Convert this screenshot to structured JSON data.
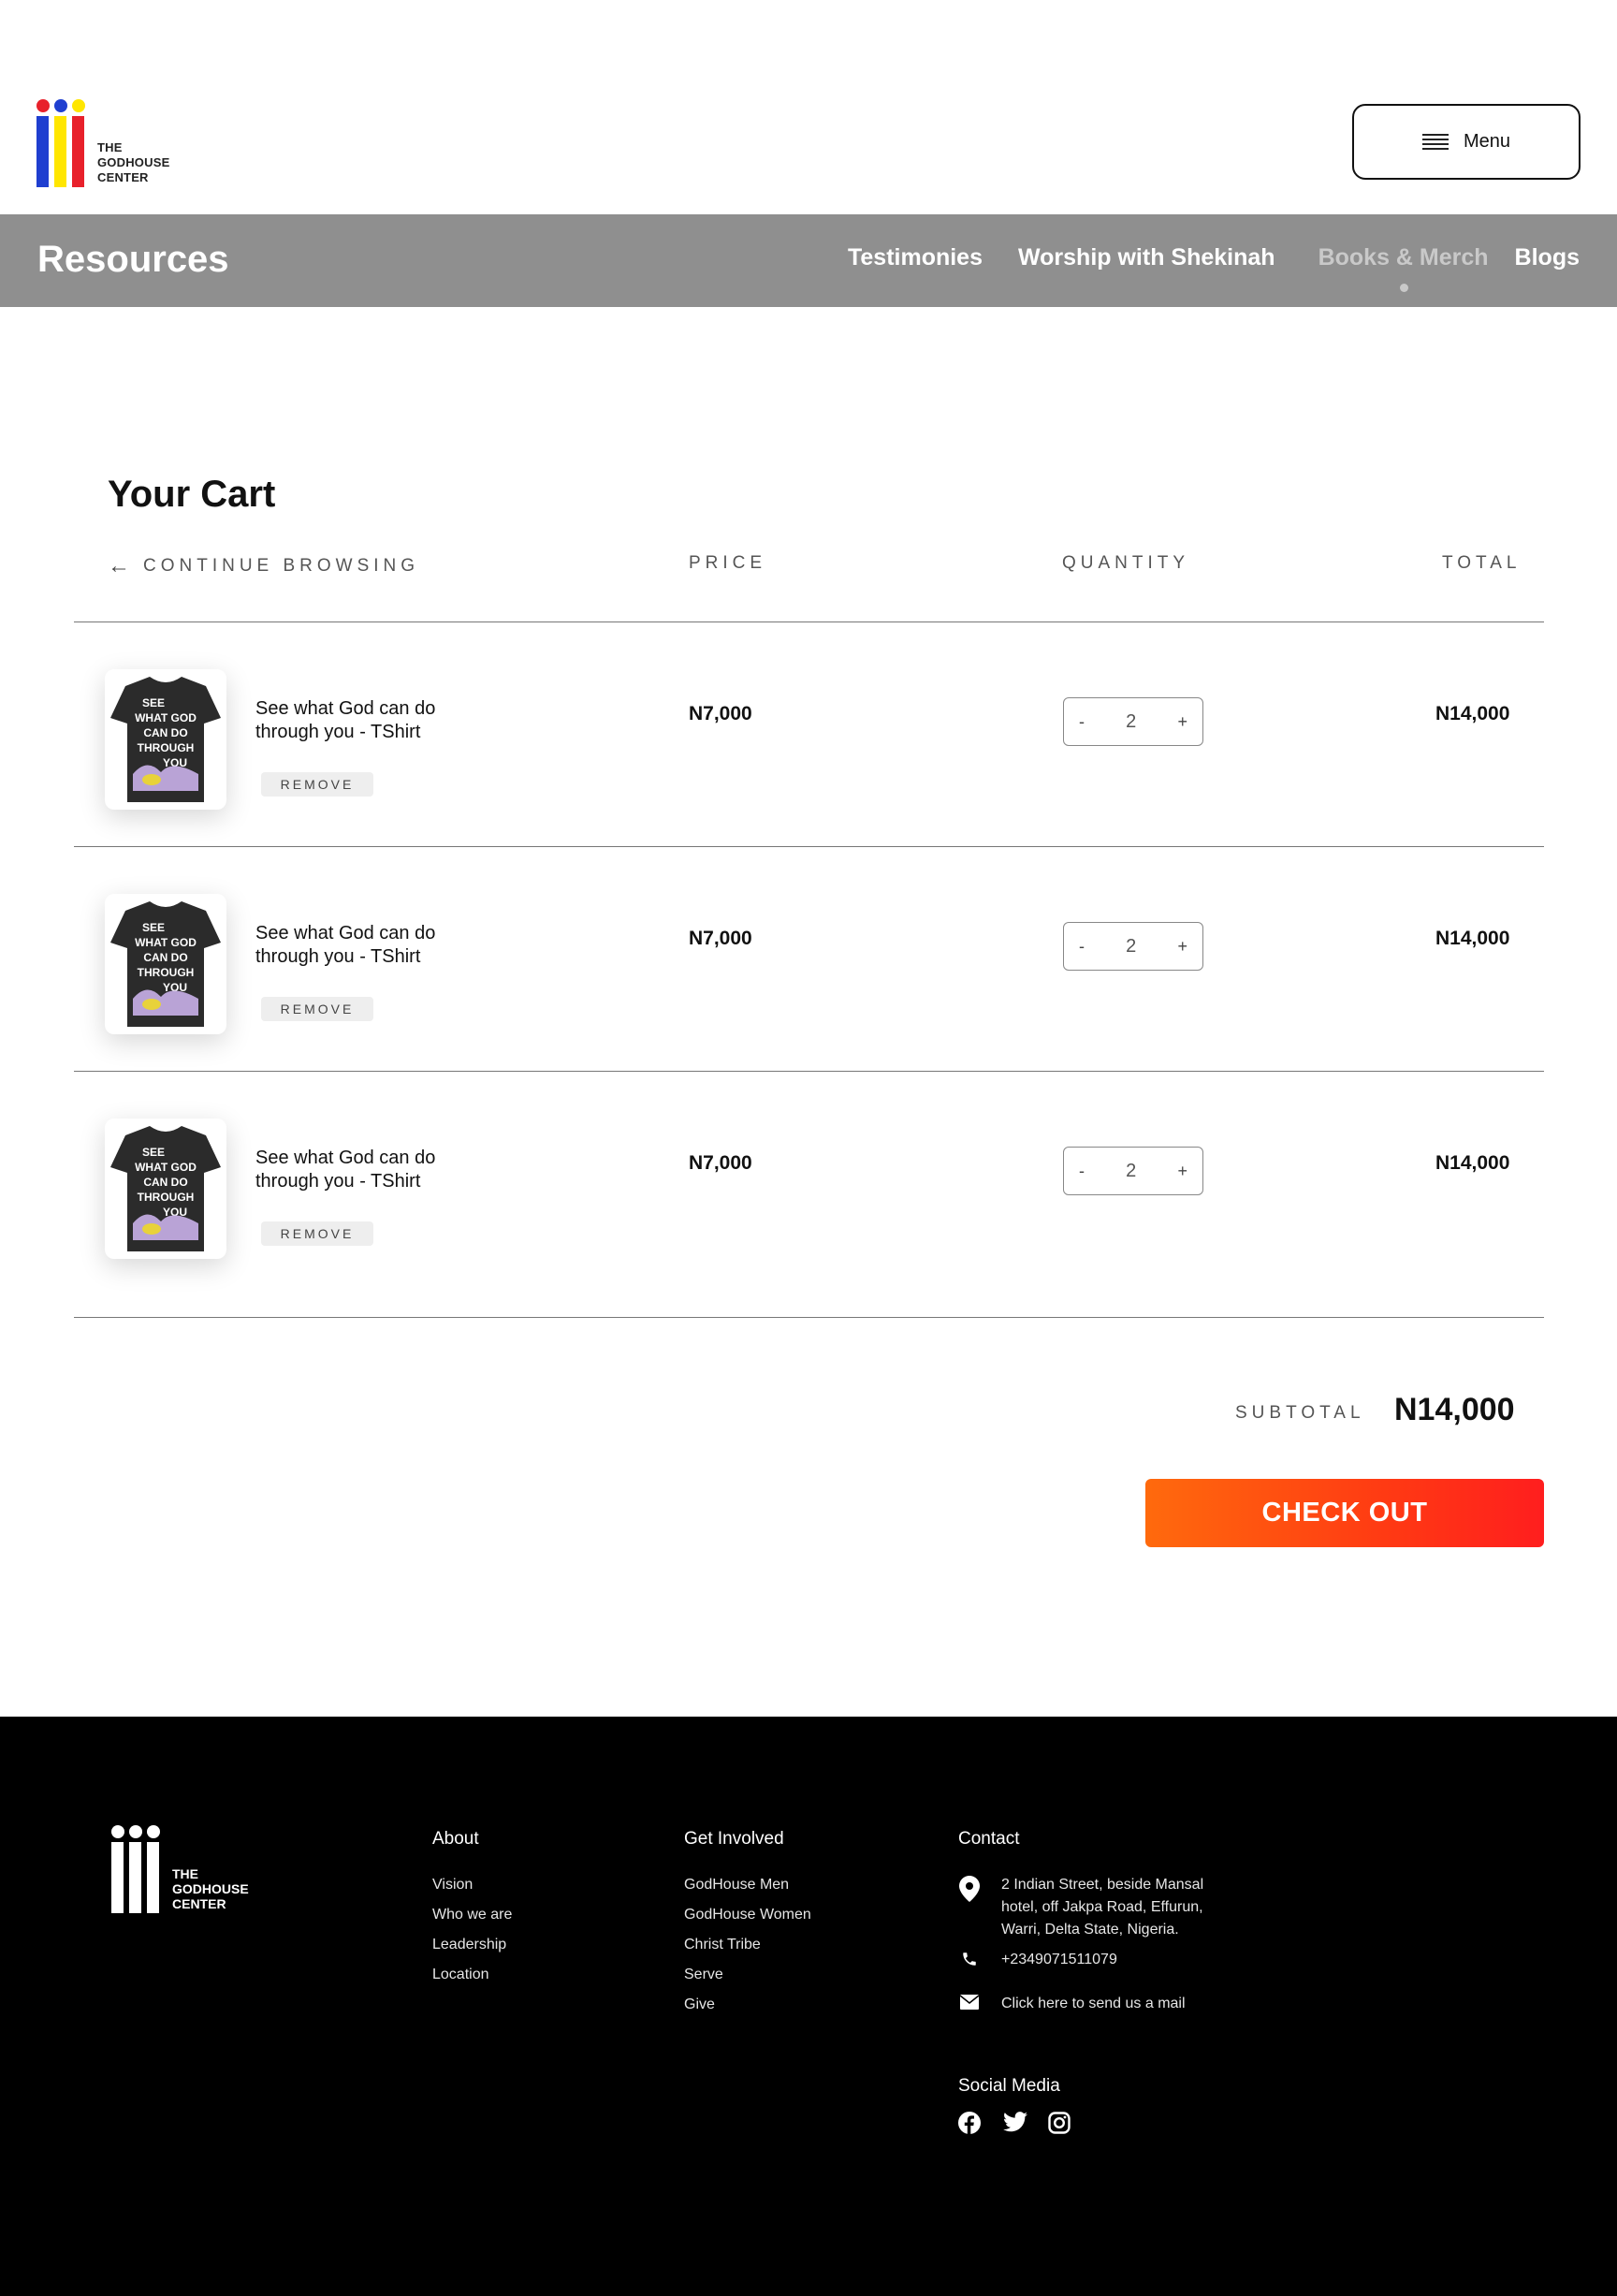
{
  "header": {
    "brand_lines": "THE\nGODHOUSE\nCENTER",
    "menu_label": "Menu"
  },
  "subnav": {
    "title": "Resources",
    "links": [
      "Testimonies",
      "Worship with Shekinah",
      "Books & Merch",
      "Blogs"
    ],
    "active": "Books & Merch"
  },
  "cart": {
    "title": "Your Cart",
    "continue_label": "CONTINUE BROWSING",
    "col_price": "PRICE",
    "col_quantity": "QUANTITY",
    "col_total": "TOTAL",
    "items": [
      {
        "name": "See what God can do through you - TShirt",
        "remove": "REMOVE",
        "price": "N7,000",
        "qty_minus": "-",
        "qty": "2",
        "qty_plus": "+",
        "total": "N14,000",
        "shirt_text": "SEE\nWHAT GOD\nCAN DO\nTHROUGH\nYOU"
      },
      {
        "name": "See what God can do through you - TShirt",
        "remove": "REMOVE",
        "price": "N7,000",
        "qty_minus": "-",
        "qty": "2",
        "qty_plus": "+",
        "total": "N14,000",
        "shirt_text": "SEE\nWHAT GOD\nCAN DO\nTHROUGH\nYOU"
      },
      {
        "name": "See what God can do through you - TShirt",
        "remove": "REMOVE",
        "price": "N7,000",
        "qty_minus": "-",
        "qty": "2",
        "qty_plus": "+",
        "total": "N14,000",
        "shirt_text": "SEE\nWHAT GOD\nCAN DO\nTHROUGH\nYOU"
      }
    ],
    "subtotal_label": "SUBTOTAL",
    "subtotal_value": "N14,000",
    "checkout_label": "CHECK OUT"
  },
  "footer": {
    "brand_lines": "THE\nGODHOUSE\nCENTER",
    "about": {
      "title": "About",
      "links": [
        "Vision",
        "Who we are",
        "Leadership",
        "Location"
      ]
    },
    "involved": {
      "title": "Get Involved",
      "links": [
        "GodHouse Men",
        "GodHouse Women",
        "Christ Tribe",
        "Serve",
        "Give"
      ]
    },
    "contact": {
      "title": "Contact",
      "address": "2 Indian Street, beside Mansal hotel, off Jakpa Road, Effurun, Warri, Delta State, Nigeria.",
      "phone": "+2349071511079",
      "mail": "Click here to send us a mail"
    },
    "social_title": "Social Media",
    "social_icons": [
      "facebook-icon",
      "twitter-icon",
      "instagram-icon"
    ]
  },
  "colors": {
    "subnav_bg": "#8f8f8f",
    "checkout_start": "#ff6a0d",
    "checkout_end": "#ff1e1e",
    "logo_red": "#e8212b",
    "logo_blue": "#1f3fd0",
    "logo_yellow": "#ffe600",
    "footer_bg": "#000000"
  }
}
